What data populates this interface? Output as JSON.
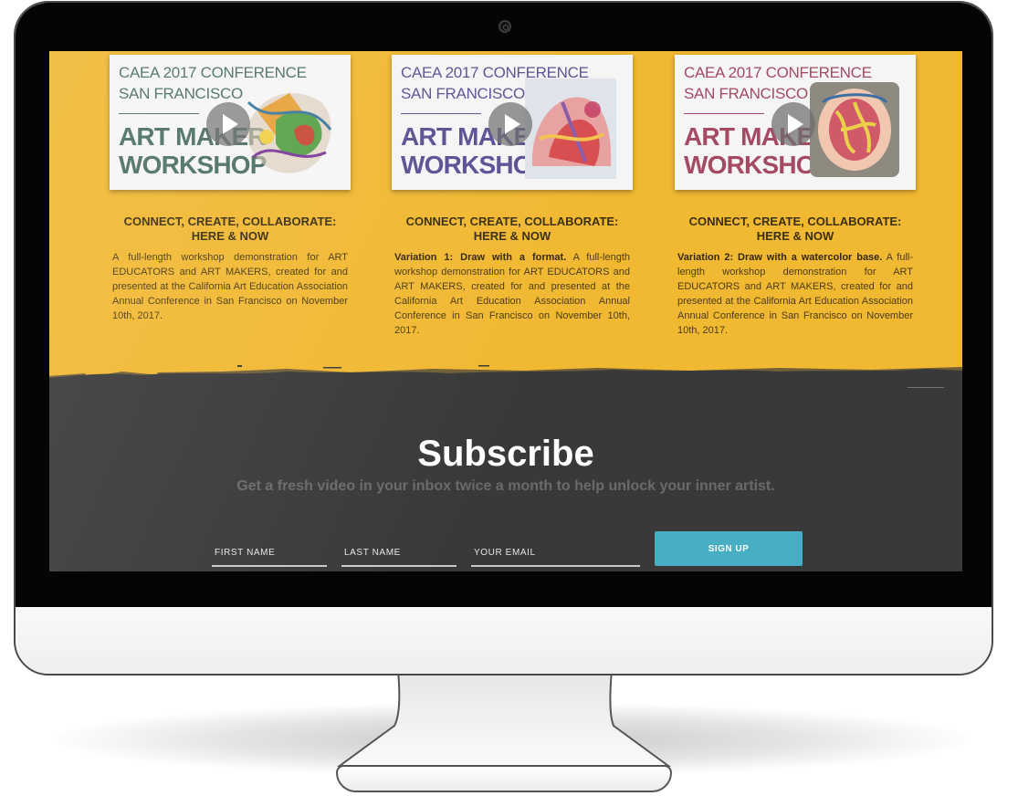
{
  "colors": {
    "page_yellow": "#f1b832",
    "page_dark": "#393939",
    "signup_button": "#48aec3"
  },
  "videos": [
    {
      "thumb_line1": "CAEA 2017 CONFERENCE",
      "thumb_line2": "SAN FRANCISCO",
      "thumb_title1": "ART MAKER",
      "thumb_title2": "WORKSHOP",
      "thumb_color": "#4c6f66",
      "heading1": "CONNECT, CREATE, COLLABORATE:",
      "heading2": "HERE & NOW",
      "lead": "",
      "description": "A full-length workshop demonstration for ART EDUCATORS and ART MAKERS, created for and presented at the California Art Education Association Annual Conference in San Francisco on November 10th, 2017.",
      "play_icon": "play-icon"
    },
    {
      "thumb_line1": "CAEA 2017 CONFERENCE",
      "thumb_line2": "SAN FRANCISCO",
      "thumb_title1": "ART MAKER",
      "thumb_title2": "WORKSHOP",
      "thumb_color": "#5c4f93",
      "heading1": "CONNECT, CREATE, COLLABORATE:",
      "heading2": "HERE & NOW",
      "lead": "Variation 1: Draw with a format.",
      "description": "A full-length workshop demonstration for ART EDUCATORS and ART MAKERS, created for and presented at the California Art Education Association Annual Conference in San Francisco on November 10th, 2017.",
      "play_icon": "play-icon"
    },
    {
      "thumb_line1": "CAEA 2017 CONFERENCE",
      "thumb_line2": "SAN FRANCISCO",
      "thumb_title1": "ART MAKER",
      "thumb_title2": "WORKSHOP",
      "thumb_color": "#a54a63",
      "heading1": "CONNECT, CREATE, COLLABORATE:",
      "heading2": "HERE & NOW",
      "lead": "Variation 2: Draw with a watercolor base.",
      "description": "A full-length workshop demonstration for ART EDUCATORS and ART MAKERS, created for and presented at the California Art Education Association Annual Conference in San Francisco on November 10th, 2017.",
      "play_icon": "play-icon"
    }
  ],
  "subscribe": {
    "title": "Subscribe",
    "subtitle": "Get a fresh video in your inbox twice a month to help unlock your inner artist.",
    "first_name_placeholder": "FIRST NAME",
    "last_name_placeholder": "LAST NAME",
    "email_placeholder": "YOUR EMAIL",
    "button_label": "SIGN UP"
  }
}
